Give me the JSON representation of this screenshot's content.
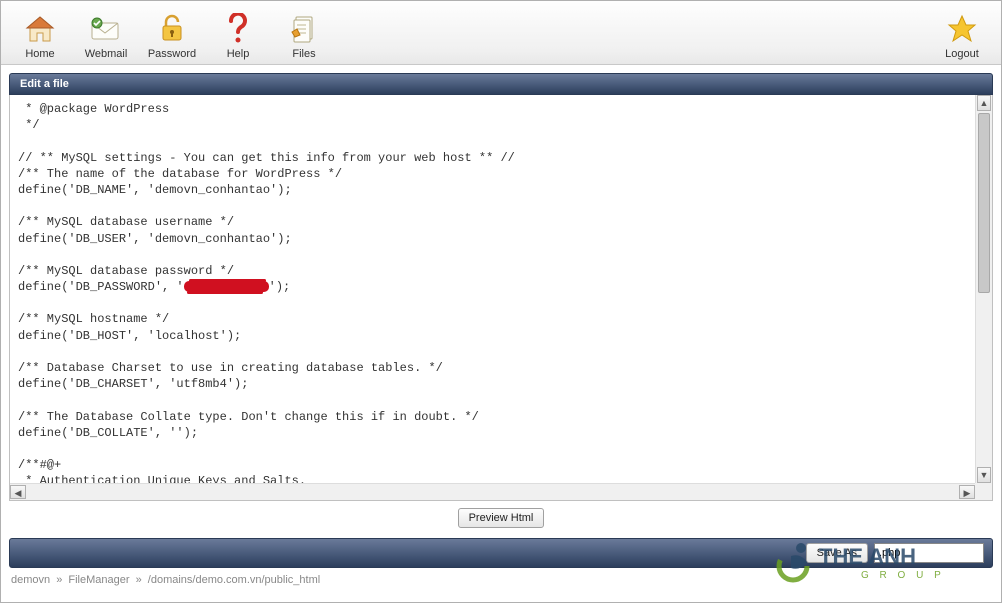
{
  "toolbar": {
    "home": "Home",
    "webmail": "Webmail",
    "password": "Password",
    "help": "Help",
    "files": "Files",
    "logout": "Logout"
  },
  "panel": {
    "title": "Edit a file"
  },
  "editor": {
    "line_pkg": " * @package WordPress",
    "line_pkg2": " */",
    "line_mysql_hdr": "// ** MySQL settings - You can get this info from your web host ** //",
    "line_dbname_c": "/** The name of the database for WordPress */",
    "line_dbname": "define('DB_NAME', 'demovn_conhantao');",
    "line_dbuser_c": "/** MySQL database username */",
    "line_dbuser": "define('DB_USER', 'demovn_conhantao');",
    "line_dbpass_c": "/** MySQL database password */",
    "line_dbpass_pre": "define('DB_PASSWORD', '",
    "line_dbpass_post": "');",
    "line_dbhost_c": "/** MySQL hostname */",
    "line_dbhost": "define('DB_HOST', 'localhost');",
    "line_charset_c": "/** Database Charset to use in creating database tables. */",
    "line_charset": "define('DB_CHARSET', 'utf8mb4');",
    "line_collate_c": "/** The Database Collate type. Don't change this if in doubt. */",
    "line_collate": "define('DB_COLLATE', '');",
    "line_auth1": "/**#@+",
    "line_auth2": " * Authentication Unique Keys and Salts."
  },
  "buttons": {
    "preview": "Preview Html",
    "save_as": "Save As"
  },
  "save_as_input": {
    "value": ".php"
  },
  "breadcrumb": {
    "user": "demovn",
    "sep": "»",
    "fm": "FileManager",
    "path": "/domains/demo.com.vn/public_html"
  },
  "watermark": {
    "brand_main": "THE ANH",
    "brand_sub": "G R O U P"
  }
}
